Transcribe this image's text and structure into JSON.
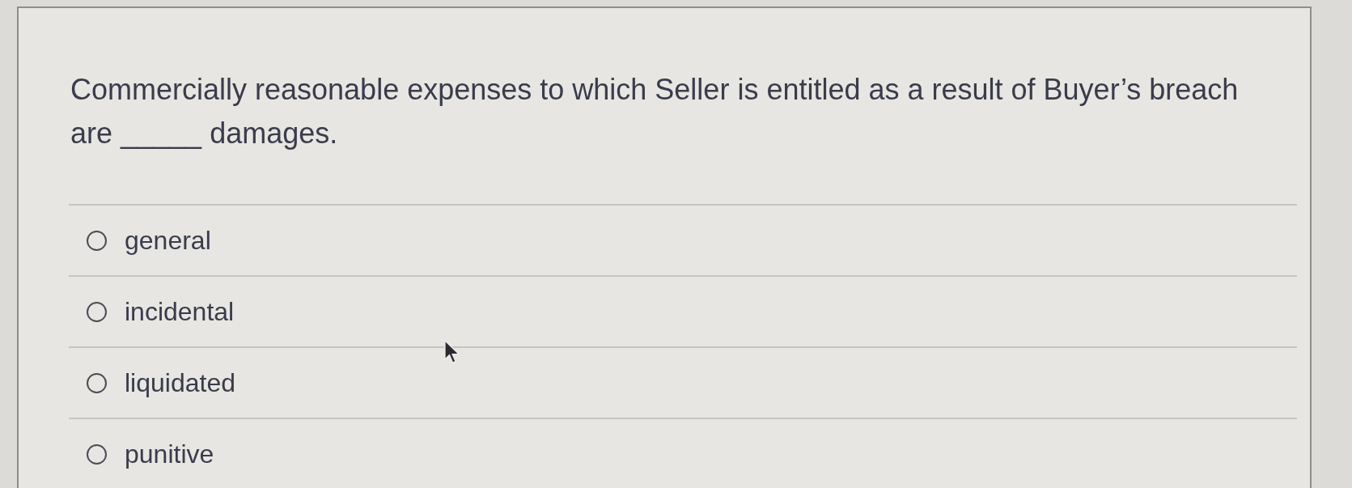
{
  "question": {
    "text": "Commercially reasonable expenses to which Seller is entitled as a result of Buyer’s breach are _____ damages."
  },
  "options": [
    {
      "label": "general",
      "selected": false
    },
    {
      "label": "incidental",
      "selected": false
    },
    {
      "label": "liquidated",
      "selected": false
    },
    {
      "label": "punitive",
      "selected": false
    }
  ]
}
